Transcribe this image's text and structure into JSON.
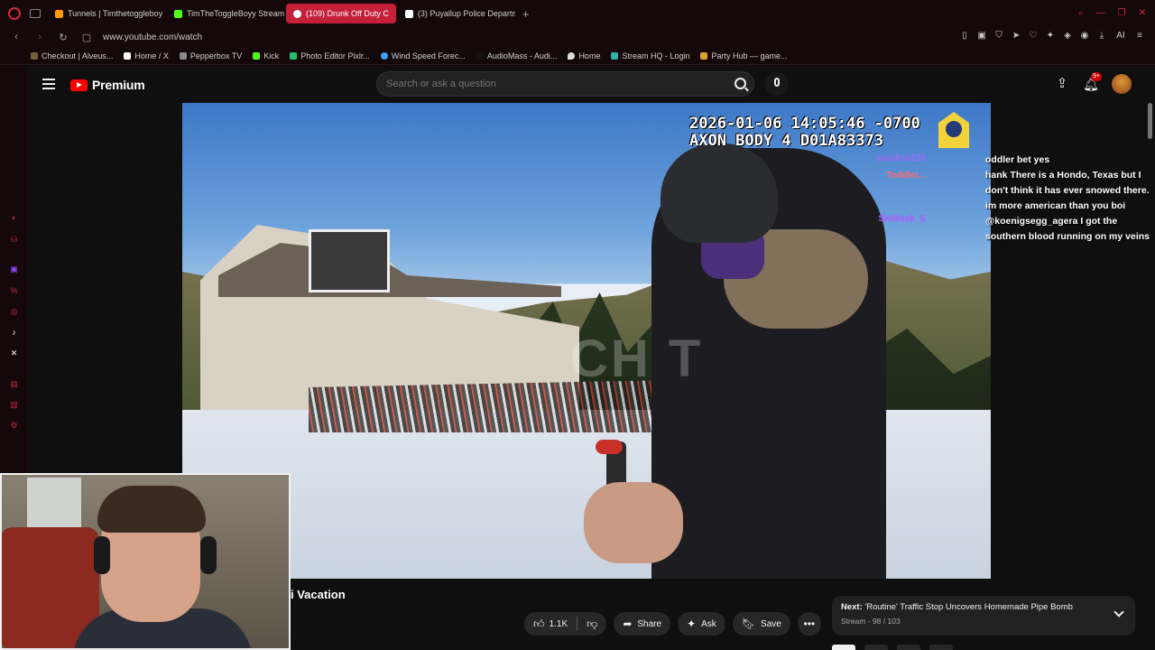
{
  "browser": {
    "tabs": [
      {
        "label": "Tunnels | Timthetoggleboy",
        "active": false,
        "fav_color": "#ff9900"
      },
      {
        "label": "TimTheToggleBoyy Stream",
        "active": false,
        "fav_color": "#53fc18"
      },
      {
        "label": "(109) Drunk Off Duty C",
        "active": true,
        "fav_color": "#ff0000"
      },
      {
        "label": "(3) Puyallup Police Departm",
        "active": false,
        "fav_color": "#ffffff"
      }
    ],
    "new_tab": "+",
    "url": "www.youtube.com/watch",
    "bookmarks": [
      {
        "label": "Checkout | Alveus...",
        "fav_color": "#7a5a3a"
      },
      {
        "label": "Home / X",
        "fav_color": "#ffffff"
      },
      {
        "label": "Pepperbox TV",
        "fav_color": "#888888"
      },
      {
        "label": "Kick",
        "fav_color": "#53fc18"
      },
      {
        "label": "Photo Editor Pixlr...",
        "fav_color": "#25c26e"
      },
      {
        "label": "Wind Speed Forec...",
        "fav_color": "#3aa0ff"
      },
      {
        "label": "AudioMass - Audi...",
        "fav_color": "#111111"
      },
      {
        "label": "Home",
        "fav_color": "#dddddd"
      },
      {
        "label": "Stream HQ - Login",
        "fav_color": "#2ab7a9"
      },
      {
        "label": "Party Hub — game...",
        "fav_color": "#e0a030"
      }
    ],
    "accent": "#c4203a"
  },
  "youtube": {
    "brand": "Premium",
    "search_placeholder": "Search or ask a question",
    "notifications_badge": "9+",
    "video": {
      "timestamp_line1": "2026-01-06 14:05:46 -0700",
      "timestamp_line2": "AXON BODY 4 D01A83373",
      "watermark": "CH T"
    },
    "overlay_chat_names": [
      "jacobsa210",
      "Toddler...",
      "SkiMask_S"
    ],
    "chat_messages": [
      "oddler bet yes",
      "hank There is a Hondo, Texas but I don't think it has ever snowed there.",
      "im more american than you boi @koenigsegg_agera I got the southern blood running on my veins"
    ],
    "title_partial": "i Vacation",
    "actions": {
      "like_count": "1.1K",
      "share": "Share",
      "ask": "Ask",
      "save": "Save"
    },
    "next": {
      "label": "Next:",
      "title": "'Routine' Traffic Stop Uncovers Homemade Pipe Bomb",
      "meta": "Stream - 98 / 103"
    }
  }
}
